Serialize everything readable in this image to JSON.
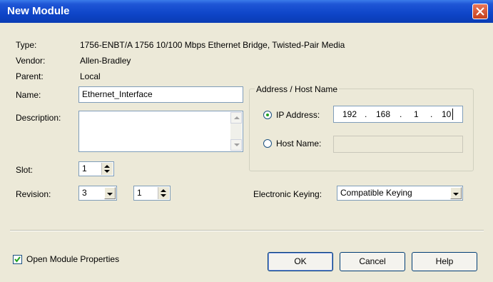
{
  "window": {
    "title": "New Module"
  },
  "info": {
    "type_label": "Type:",
    "type_value": "1756-ENBT/A 1756 10/100 Mbps Ethernet Bridge, Twisted-Pair Media",
    "vendor_label": "Vendor:",
    "vendor_value": "Allen-Bradley",
    "parent_label": "Parent:",
    "parent_value": "Local"
  },
  "name": {
    "label": "Name:",
    "value": "Ethernet_Interface"
  },
  "description": {
    "label": "Description:",
    "value": ""
  },
  "slot": {
    "label": "Slot:",
    "value": "1"
  },
  "revision": {
    "label": "Revision:",
    "major": "3",
    "minor": "1"
  },
  "address": {
    "group_label": "Address / Host Name",
    "ip_label": "IP Address:",
    "ip_selected": true,
    "ip_octets": [
      "192",
      "168",
      "1",
      "10"
    ],
    "ip_separator": ".",
    "host_label": "Host Name:",
    "host_value": ""
  },
  "keying": {
    "label": "Electronic Keying:",
    "value": "Compatible Keying"
  },
  "open_props": {
    "label": "Open Module Properties",
    "checked": true
  },
  "buttons": {
    "ok": "OK",
    "cancel": "Cancel",
    "help": "Help"
  },
  "colors": {
    "titlebar": "#0e45c8",
    "dialog_bg": "#ece9d8",
    "close": "#c6411c"
  }
}
